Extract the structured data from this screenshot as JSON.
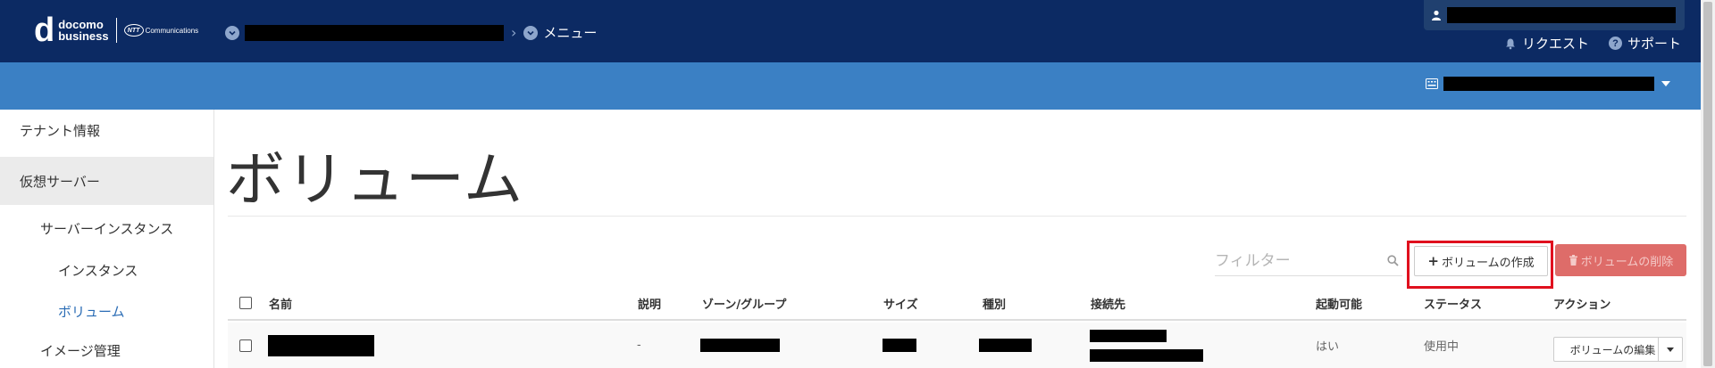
{
  "header": {
    "logo": {
      "mark": "d",
      "line1": "docomo",
      "line2": "business",
      "ntt_oval": "NTT",
      "ntt_text": "Communications"
    },
    "breadcrumb": {
      "menu_label": "メニュー"
    },
    "links": {
      "request": "リクエスト",
      "support": "サポート"
    },
    "colors": {
      "header_bg": "#0c2a63",
      "subbar_bg": "#3b80c4"
    }
  },
  "sidebar": {
    "items": [
      {
        "label": "テナント情報"
      },
      {
        "label": "仮想サーバー"
      },
      {
        "label": "サーバーインスタンス"
      },
      {
        "label": "インスタンス"
      },
      {
        "label": "ボリューム"
      },
      {
        "label": "イメージ管理"
      }
    ]
  },
  "main": {
    "title": "ボリューム",
    "filter_placeholder": "フィルター",
    "create_button": "ボリュームの作成",
    "create_plus": "+",
    "delete_button": "ボリュームの削除",
    "columns": [
      "名前",
      "説明",
      "ゾーン/グループ",
      "サイズ",
      "種別",
      "接続先",
      "起動可能",
      "ステータス",
      "アクション"
    ],
    "rows": [
      {
        "description": "-",
        "bootable": "はい",
        "status": "使用中",
        "action": "ボリュームの編集"
      }
    ]
  },
  "icons": [
    "user-icon",
    "bell-icon",
    "question-icon",
    "chevron-down-icon",
    "search-icon",
    "trash-icon",
    "keyboard-icon"
  ]
}
